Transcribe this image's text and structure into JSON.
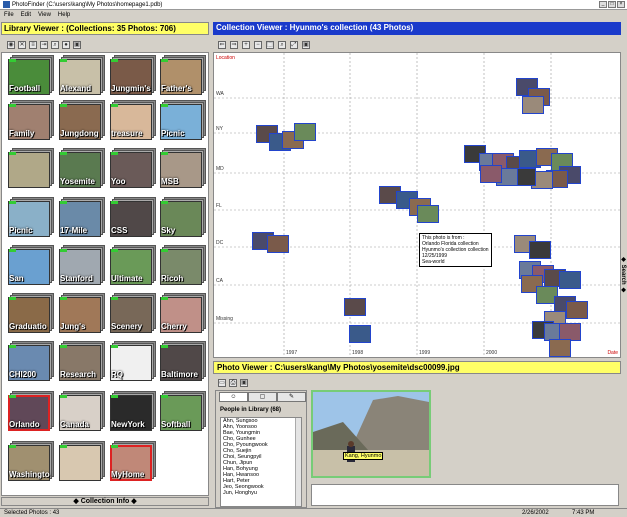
{
  "window": {
    "title": "PhotoFinder (C:\\users\\kang\\My Photos\\homepage1.pdb)",
    "min": "_",
    "max": "□",
    "close": "×"
  },
  "menu": [
    "File",
    "Edit",
    "View",
    "Help"
  ],
  "library": {
    "header": "Library Viewer : (Collections: 35 Photos: 706)",
    "collections": [
      {
        "label": "Football",
        "color": "#4a8c3a"
      },
      {
        "label": "Alexand",
        "color": "#c8c0a8"
      },
      {
        "label": "Jungmin's",
        "color": "#7a5a48"
      },
      {
        "label": "Father's",
        "color": "#b0906a"
      },
      {
        "label": "Family",
        "color": "#a08070"
      },
      {
        "label": "Jungdong",
        "color": "#8a6a50"
      },
      {
        "label": "treasure",
        "color": "#d8b89a"
      },
      {
        "label": "Picnic",
        "color": "#7ab0d8"
      },
      {
        "label": "",
        "color": "#b0a888"
      },
      {
        "label": "Yosemite",
        "color": "#5a7a50"
      },
      {
        "label": "Yoo",
        "color": "#6a5a58"
      },
      {
        "label": "MSB",
        "color": "#a89888"
      },
      {
        "label": "Picnic",
        "color": "#8ab0c8"
      },
      {
        "label": "17-Mile",
        "color": "#6a8aa8"
      },
      {
        "label": "CSS",
        "color": "#504848"
      },
      {
        "label": "Sky",
        "color": "#6a8858"
      },
      {
        "label": "San",
        "color": "#6aa0d0"
      },
      {
        "label": "Stanford",
        "color": "#a0a8b0"
      },
      {
        "label": "Ultimate",
        "color": "#6a9a58"
      },
      {
        "label": "Ricoh",
        "color": "#7a8a6a"
      },
      {
        "label": "Graduatio",
        "color": "#8a6a48"
      },
      {
        "label": "Jung's",
        "color": "#a07858"
      },
      {
        "label": "Scenery",
        "color": "#786858"
      },
      {
        "label": "Cherry",
        "color": "#c09088"
      },
      {
        "label": "CHI200",
        "color": "#6a8ab0"
      },
      {
        "label": "Research",
        "color": "#887868"
      },
      {
        "label": "RQ",
        "color": "#f0f0f0"
      },
      {
        "label": "Baltimore",
        "color": "#504848"
      },
      {
        "label": "Orlando",
        "color": "#604858"
      },
      {
        "label": "Canada",
        "color": "#d8d0c8"
      },
      {
        "label": "NewYork",
        "color": "#2a2a2a"
      },
      {
        "label": "Softball",
        "color": "#6a9a58"
      },
      {
        "label": "Washingto",
        "color": "#a09070"
      },
      {
        "label": "",
        "color": "#d8c8b0"
      },
      {
        "label": "MyHome",
        "color": "#c08878"
      }
    ],
    "footer": "Collection Info"
  },
  "collection": {
    "header": "Collection Viewer : Hyunmo's collection (43 Photos)",
    "y_axis_title": "Location",
    "y_labels": [
      "WA",
      "NY",
      "MD",
      "FL",
      "DC",
      "CA",
      "Missing"
    ],
    "x_labels": [
      "1997",
      "1998",
      "1999",
      "2000",
      "2001"
    ],
    "x_axis_title": "Date",
    "search_tab": "◆ Search ◆",
    "tooltip": [
      "This photo is from :",
      "Orlando Florida collection",
      "Hyunmo's collection collection",
      "12/25/1999",
      "Sea-world"
    ]
  },
  "photo_viewer": {
    "header": "Photo Viewer : C:\\users\\kang\\My Photos\\yosemite\\dsc00099.jpg",
    "people_title": "People in Library (68)",
    "people": [
      "Ahn, Sungsoo",
      "Ahn, Yoonsoo",
      "Bae, Youngmin",
      "Cho, Gunhee",
      "Cho, Pyoungwook",
      "Cho, Suejin",
      "Choi, Seungpyil",
      "Chun, Jipun",
      "Han, Bohyung",
      "Han, Hwansoo",
      "Hart, Peter",
      "Jeo, Seongwook",
      "Jun, Honghyu"
    ],
    "photo_tag": "Kang, Hyunmo"
  },
  "status": {
    "selected": "Selected Photos : 43",
    "date": "2/26/2002",
    "time": "7:43 PM"
  },
  "colors": {
    "library_header": "#ffff66",
    "collection_header": "#1a3acb",
    "thumb_border": "#2244cc",
    "selected_border": "#dd2222"
  }
}
